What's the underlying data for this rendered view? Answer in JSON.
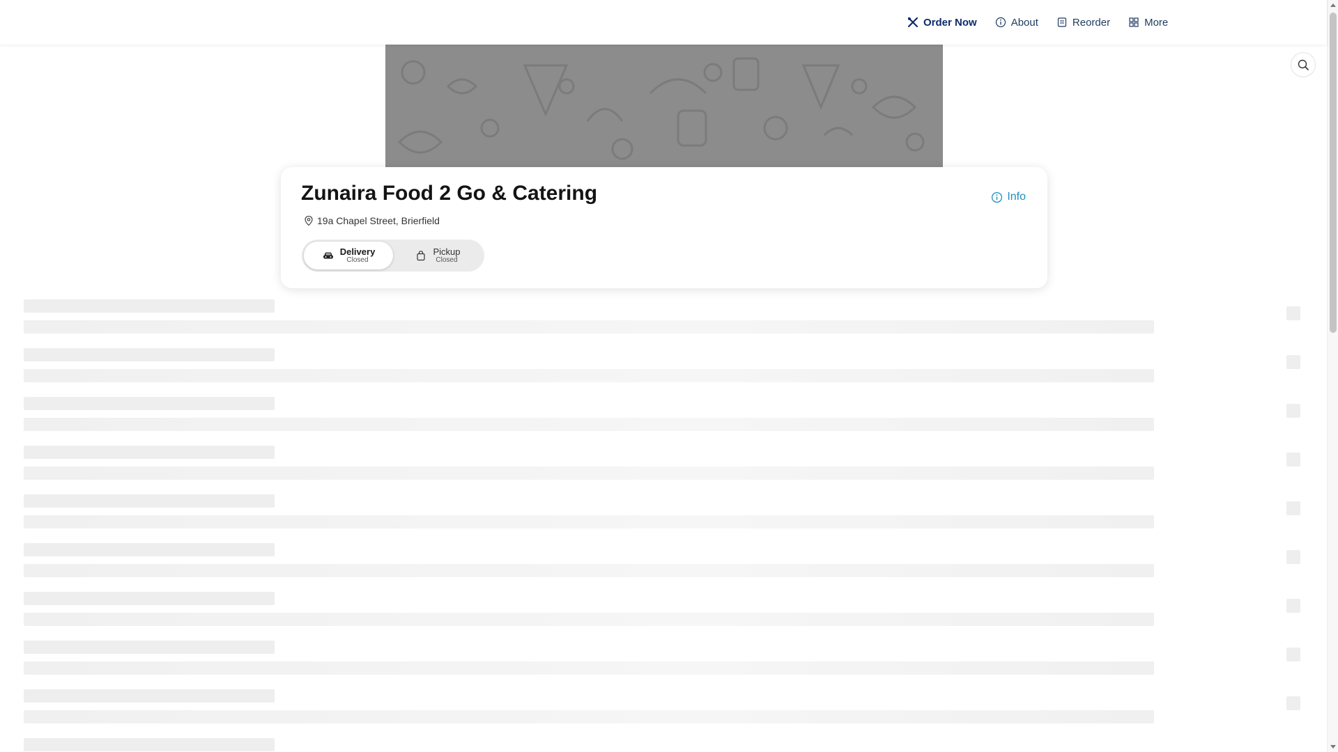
{
  "nav": {
    "items": [
      {
        "label": "Order Now",
        "icon": "utensils-icon",
        "active": true
      },
      {
        "label": "About",
        "icon": "info-icon",
        "active": false
      },
      {
        "label": "Reorder",
        "icon": "receipt-icon",
        "active": false
      },
      {
        "label": "More",
        "icon": "grid-icon",
        "active": false
      }
    ]
  },
  "banner": {
    "icon": "food-pattern-image"
  },
  "search": {
    "icon": "search-icon"
  },
  "store": {
    "name": "Zunaira Food 2 Go & Catering",
    "address": "19a Chapel Street, Brierfield",
    "info_label": "Info"
  },
  "modes": [
    {
      "label": "Delivery",
      "status": "Closed",
      "icon": "car-icon",
      "selected": true
    },
    {
      "label": "Pickup",
      "status": "Closed",
      "icon": "bag-icon",
      "selected": false
    }
  ],
  "colors": {
    "nav_text": "#1f3a5f",
    "nav_active": "#0d2b6b",
    "info_link": "#1a8fbf",
    "banner_bg": "#8f8f8f",
    "skeleton": "#f1f1f1"
  }
}
